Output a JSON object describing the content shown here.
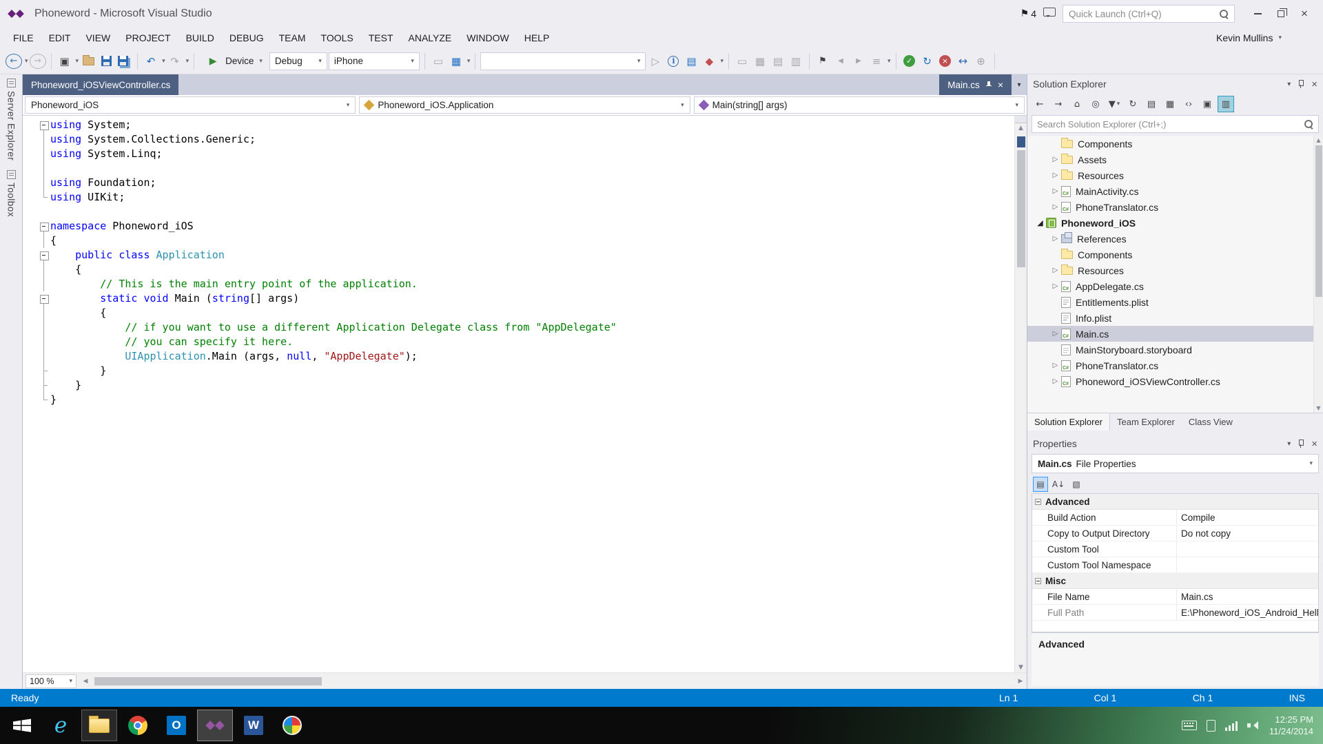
{
  "colors": {
    "accent": "#007ACC",
    "tab_inactive": "#4D6082",
    "selection": "#CCCEDB",
    "code_keyword": "#0000FF",
    "code_type": "#2B91AF",
    "code_comment": "#008000",
    "code_string": "#A31515",
    "vs_purple": "#68217A",
    "run_green": "#388A34"
  },
  "icons": {
    "caret_down": "▾",
    "back": "←",
    "forward": "→",
    "undo": "↶",
    "redo": "↷",
    "run": "▶",
    "play_outline": "▷",
    "flag": "⚑",
    "check": "✓",
    "sync": "↻",
    "close": "×",
    "up": "▲",
    "down": "▼",
    "left": "◀",
    "right": "▶",
    "home": "⌂",
    "menu": "≡",
    "compare": "↔",
    "plus_circle": "⊕",
    "rect": "▭",
    "grid": "▦",
    "table": "▤",
    "rows": "▥",
    "boxed": "▣",
    "diamond": "◆",
    "target": "◎",
    "code_tags": "‹›",
    "collapsed_expander": "▷",
    "expanded_expander": "◢"
  },
  "title_bar": {
    "app_title": "Phoneword - Microsoft Visual Studio",
    "notifications_count": "4",
    "quick_launch_placeholder": "Quick Launch (Ctrl+Q)"
  },
  "menu_bar": {
    "items": [
      "FILE",
      "EDIT",
      "VIEW",
      "PROJECT",
      "BUILD",
      "DEBUG",
      "TEAM",
      "TOOLS",
      "TEST",
      "ANALYZE",
      "WINDOW",
      "HELP"
    ],
    "user_name": "Kevin Mullins"
  },
  "toolbar": {
    "device_label": "Device",
    "debug_value": "Debug",
    "platform_value": "iPhone",
    "find_value": ""
  },
  "left_rail": {
    "tabs": [
      "Server Explorer",
      "Toolbox"
    ]
  },
  "editor": {
    "tabs": {
      "open": "Phoneword_iOSViewController.cs",
      "preview": "Main.cs"
    },
    "nav": {
      "project": "Phoneword_iOS",
      "type": "Phoneword_iOS.Application",
      "member": "Main(string[] args)"
    },
    "zoom": "100 %",
    "code_lines": [
      {
        "g": "box",
        "tokens": [
          {
            "c": "k",
            "t": "using"
          },
          {
            "c": "p",
            "t": " System;"
          }
        ]
      },
      {
        "g": "line",
        "tokens": [
          {
            "c": "k",
            "t": "using"
          },
          {
            "c": "p",
            "t": " System.Collections.Generic;"
          }
        ]
      },
      {
        "g": "line",
        "tokens": [
          {
            "c": "k",
            "t": "using"
          },
          {
            "c": "p",
            "t": " System.Linq;"
          }
        ]
      },
      {
        "g": "line",
        "tokens": []
      },
      {
        "g": "line",
        "tokens": [
          {
            "c": "k",
            "t": "using"
          },
          {
            "c": "p",
            "t": " Foundation;"
          }
        ]
      },
      {
        "g": "end",
        "tokens": [
          {
            "c": "k",
            "t": "using"
          },
          {
            "c": "p",
            "t": " UIKit;"
          }
        ]
      },
      {
        "g": "",
        "tokens": []
      },
      {
        "g": "box",
        "tokens": [
          {
            "c": "k",
            "t": "namespace"
          },
          {
            "c": "p",
            "t": " Phoneword_iOS"
          }
        ]
      },
      {
        "g": "line",
        "tokens": [
          {
            "c": "p",
            "t": "{"
          }
        ]
      },
      {
        "g": "box",
        "tokens": [
          {
            "c": "p",
            "t": "    "
          },
          {
            "c": "k",
            "t": "public"
          },
          {
            "c": "p",
            "t": " "
          },
          {
            "c": "k",
            "t": "class"
          },
          {
            "c": "p",
            "t": " "
          },
          {
            "c": "t",
            "t": "Application"
          }
        ]
      },
      {
        "g": "line",
        "tokens": [
          {
            "c": "p",
            "t": "    {"
          }
        ]
      },
      {
        "g": "line",
        "tokens": [
          {
            "c": "c",
            "t": "        // This is the main entry point of the application."
          }
        ]
      },
      {
        "g": "box",
        "tokens": [
          {
            "c": "p",
            "t": "        "
          },
          {
            "c": "k",
            "t": "static"
          },
          {
            "c": "p",
            "t": " "
          },
          {
            "c": "k",
            "t": "void"
          },
          {
            "c": "p",
            "t": " Main ("
          },
          {
            "c": "k",
            "t": "string"
          },
          {
            "c": "p",
            "t": "[] args)"
          }
        ]
      },
      {
        "g": "line",
        "tokens": [
          {
            "c": "p",
            "t": "        {"
          }
        ]
      },
      {
        "g": "line",
        "tokens": [
          {
            "c": "c",
            "t": "            // if you want to use a different Application Delegate class from \"AppDelegate\""
          }
        ]
      },
      {
        "g": "line",
        "tokens": [
          {
            "c": "c",
            "t": "            // you can specify it here."
          }
        ]
      },
      {
        "g": "line",
        "tokens": [
          {
            "c": "p",
            "t": "            "
          },
          {
            "c": "t",
            "t": "UIApplication"
          },
          {
            "c": "p",
            "t": ".Main (args, "
          },
          {
            "c": "k",
            "t": "null"
          },
          {
            "c": "p",
            "t": ", "
          },
          {
            "c": "s",
            "t": "\"AppDelegate\""
          },
          {
            "c": "p",
            "t": ");"
          }
        ]
      },
      {
        "g": "tick",
        "tokens": [
          {
            "c": "p",
            "t": "        }"
          }
        ]
      },
      {
        "g": "tick",
        "tokens": [
          {
            "c": "p",
            "t": "    }"
          }
        ]
      },
      {
        "g": "end",
        "tokens": [
          {
            "c": "p",
            "t": "}"
          }
        ]
      }
    ]
  },
  "solution_explorer": {
    "title": "Solution Explorer",
    "search_placeholder": "Search Solution Explorer (Ctrl+;)",
    "tool_icons": [
      {
        "name": "back",
        "glyph": "←"
      },
      {
        "name": "forward",
        "glyph": "→"
      },
      {
        "name": "home",
        "glyph": "⌂"
      },
      {
        "name": "scope-to-this",
        "glyph": "◎"
      },
      {
        "name": "filter",
        "glyph": "▼",
        "caret": true
      },
      {
        "name": "sync-with-active-document",
        "glyph": "↻"
      },
      {
        "name": "collapse-all",
        "glyph": "▤"
      },
      {
        "name": "show-all-files",
        "glyph": "▦"
      },
      {
        "name": "view-code",
        "glyph": "‹›"
      },
      {
        "name": "properties",
        "glyph": "▣"
      },
      {
        "name": "preview-selected-items",
        "glyph": "▥",
        "active": true
      }
    ],
    "tree": [
      {
        "label": "Components",
        "icon": "folder",
        "arrow": "none",
        "level": 1
      },
      {
        "label": "Assets",
        "icon": "folder",
        "arrow": "collapsed",
        "level": 1
      },
      {
        "label": "Resources",
        "icon": "folder",
        "arrow": "collapsed",
        "level": 1
      },
      {
        "label": "MainActivity.cs",
        "icon": "csharp",
        "arrow": "collapsed",
        "level": 1
      },
      {
        "label": "PhoneTranslator.cs",
        "icon": "csharp",
        "arrow": "collapsed",
        "level": 1
      },
      {
        "label": "Phoneword_iOS",
        "icon": "project",
        "arrow": "expanded",
        "level": 0,
        "bold": true
      },
      {
        "label": "References",
        "icon": "references",
        "arrow": "collapsed",
        "level": 1
      },
      {
        "label": "Components",
        "icon": "folder",
        "arrow": "none",
        "level": 1
      },
      {
        "label": "Resources",
        "icon": "folder",
        "arrow": "collapsed",
        "level": 1
      },
      {
        "label": "AppDelegate.cs",
        "icon": "csharp",
        "arrow": "collapsed",
        "level": 1
      },
      {
        "label": "Entitlements.plist",
        "icon": "plist",
        "arrow": "none",
        "level": 1
      },
      {
        "label": "Info.plist",
        "icon": "plist",
        "arrow": "none",
        "level": 1
      },
      {
        "label": "Main.cs",
        "icon": "csharp",
        "arrow": "collapsed",
        "level": 1,
        "selected": true
      },
      {
        "label": "MainStoryboard.storyboard",
        "icon": "file",
        "arrow": "none",
        "level": 1
      },
      {
        "label": "PhoneTranslator.cs",
        "icon": "csharp",
        "arrow": "collapsed",
        "level": 1
      },
      {
        "label": "Phoneword_iOSViewController.cs",
        "icon": "csharp",
        "arrow": "collapsed",
        "level": 1
      }
    ],
    "bottom_tabs": [
      "Solution Explorer",
      "Team Explorer",
      "Class View"
    ]
  },
  "properties": {
    "title": "Properties",
    "object_name": "Main.cs",
    "object_type": "File Properties",
    "tool_icons": [
      {
        "name": "categorized",
        "glyph": "▤",
        "active": true
      },
      {
        "name": "alphabetical",
        "glyph": "A↓"
      },
      {
        "name": "property-pages",
        "glyph": "▧"
      }
    ],
    "rows": [
      {
        "type": "category",
        "label": "Advanced"
      },
      {
        "type": "row",
        "label": "Build Action",
        "value": "Compile"
      },
      {
        "type": "row",
        "label": "Copy to Output Directory",
        "value": "Do not copy"
      },
      {
        "type": "row",
        "label": "Custom Tool",
        "value": ""
      },
      {
        "type": "row",
        "label": "Custom Tool Namespace",
        "value": ""
      },
      {
        "type": "category",
        "label": "Misc"
      },
      {
        "type": "row",
        "label": "File Name",
        "value": "Main.cs"
      },
      {
        "type": "row",
        "label": "Full Path",
        "value": "E:\\Phoneword_iOS_Android_Hello",
        "readonly": true
      }
    ],
    "description_title": "Advanced"
  },
  "status_bar": {
    "status": "Ready",
    "line": "Ln 1",
    "col": "Col 1",
    "ch": "Ch 1",
    "mode": "INS"
  },
  "taskbar": {
    "clock_time": "12:25 PM",
    "clock_date": "11/24/2014"
  }
}
